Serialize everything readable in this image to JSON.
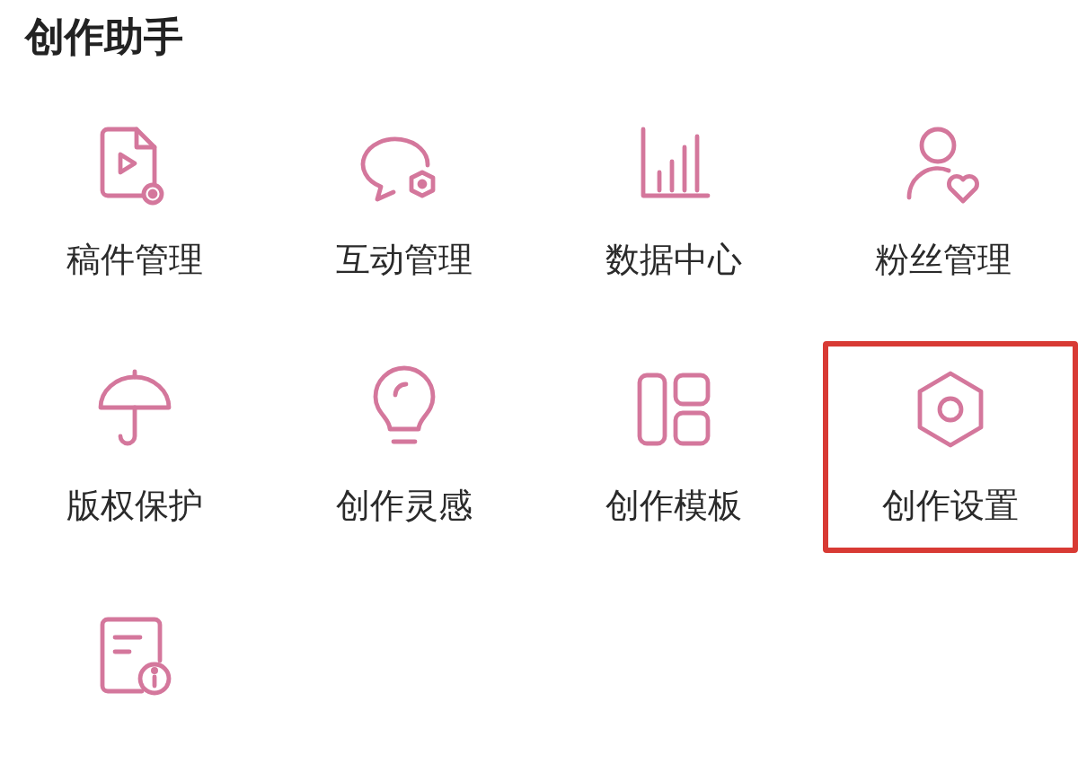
{
  "section": {
    "title": "创作助手"
  },
  "tools": [
    {
      "kind": "manuscript",
      "label": "稿件管理",
      "highlighted": false
    },
    {
      "kind": "interaction",
      "label": "互动管理",
      "highlighted": false
    },
    {
      "kind": "data",
      "label": "数据中心",
      "highlighted": false
    },
    {
      "kind": "fans",
      "label": "粉丝管理",
      "highlighted": false
    },
    {
      "kind": "copyright",
      "label": "版权保护",
      "highlighted": false
    },
    {
      "kind": "inspiration",
      "label": "创作灵感",
      "highlighted": false
    },
    {
      "kind": "template",
      "label": "创作模板",
      "highlighted": false
    },
    {
      "kind": "settings",
      "label": "创作设置",
      "highlighted": true
    },
    {
      "kind": "appeal",
      "highlighted": false
    }
  ]
}
